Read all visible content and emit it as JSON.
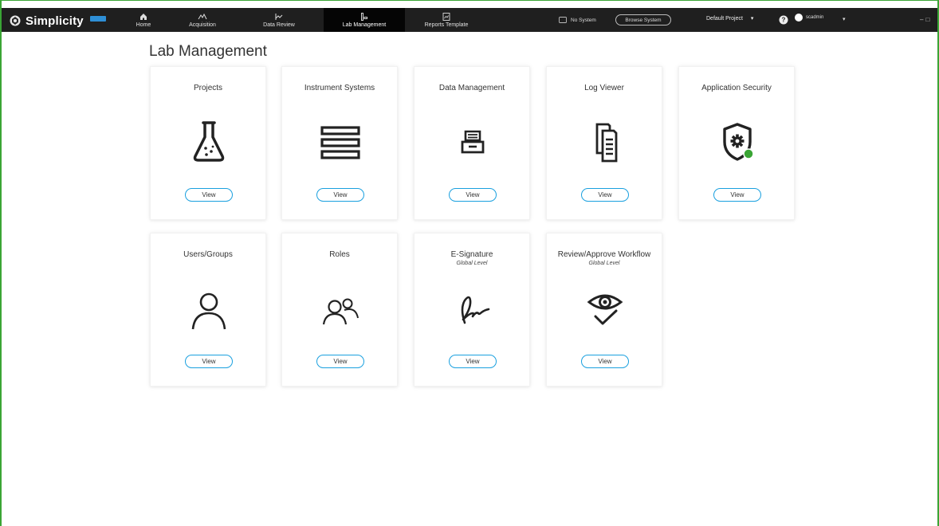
{
  "app": {
    "name": "Simplicity"
  },
  "nav": {
    "tabs": [
      {
        "label": "Home",
        "icon": "home-icon"
      },
      {
        "label": "Acquisition",
        "icon": "acquisition-icon"
      },
      {
        "label": "Data Review",
        "icon": "data-review-icon"
      },
      {
        "label": "Lab Management",
        "icon": "lab-management-icon",
        "active": true
      },
      {
        "label": "Reports Template",
        "icon": "reports-template-icon"
      }
    ]
  },
  "system": {
    "name": "No System",
    "browse_label": "Browse System"
  },
  "project": {
    "selected": "Default Project",
    "caret": "▾"
  },
  "user": {
    "name": "scadmin",
    "caret": "▾"
  },
  "page": {
    "title": "Lab Management"
  },
  "cards": [
    {
      "title": "Projects",
      "subtitle": "",
      "icon": "flask-icon",
      "button": "View"
    },
    {
      "title": "Instrument Systems",
      "subtitle": "",
      "icon": "instrument-stack-icon",
      "button": "View"
    },
    {
      "title": "Data Management",
      "subtitle": "",
      "icon": "file-drawer-icon",
      "button": "View"
    },
    {
      "title": "Log Viewer",
      "subtitle": "",
      "icon": "documents-icon",
      "button": "View"
    },
    {
      "title": "Application Security",
      "subtitle": "",
      "icon": "shield-gear-icon",
      "button": "View"
    },
    {
      "title": "Users/Groups",
      "subtitle": "",
      "icon": "user-icon",
      "button": "View"
    },
    {
      "title": "Roles",
      "subtitle": "",
      "icon": "roles-icon",
      "button": "View"
    },
    {
      "title": "E-Signature",
      "subtitle": "Global Level",
      "icon": "signature-icon",
      "button": "View"
    },
    {
      "title": "Review/Approve Workflow",
      "subtitle": "Global Level",
      "icon": "eye-check-icon",
      "button": "View"
    }
  ],
  "colors": {
    "topbar": "#1f1f1f",
    "active_tab": "#050505",
    "accent_blue": "#1aa0df",
    "status_green": "#3aa535"
  }
}
